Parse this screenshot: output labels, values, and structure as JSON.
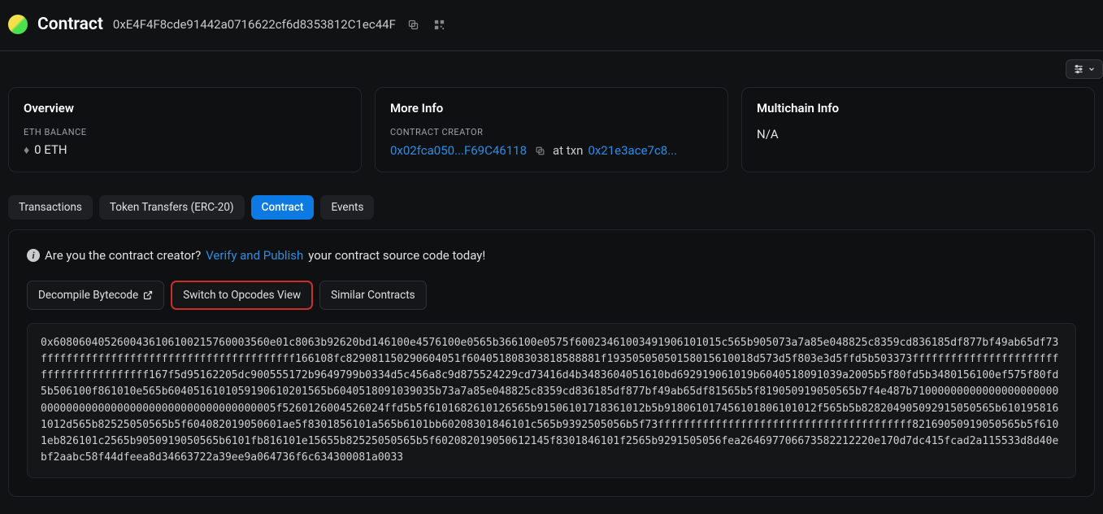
{
  "header": {
    "title": "Contract",
    "address": "0xE4F4F8cde91442a0716622cf6d8353812C1ec44F"
  },
  "cards": {
    "overview": {
      "title": "Overview",
      "balance_label": "ETH BALANCE",
      "balance_value": "0 ETH"
    },
    "moreinfo": {
      "title": "More Info",
      "creator_label": "CONTRACT CREATOR",
      "creator_address": "0x02fca050...F69C46118",
      "at_txn": "at txn",
      "txn_hash": "0x21e3ace7c8..."
    },
    "multichain": {
      "title": "Multichain Info",
      "value": "N/A"
    }
  },
  "tabs": {
    "transactions": "Transactions",
    "token_transfers": "Token Transfers (ERC-20)",
    "contract": "Contract",
    "events": "Events"
  },
  "verify": {
    "prefix": "Are you the contract creator?",
    "link": "Verify and Publish",
    "suffix": "your contract source code today!"
  },
  "actions": {
    "decompile": "Decompile Bytecode",
    "opcodes": "Switch to Opcodes View",
    "similar": "Similar Contracts"
  },
  "bytecode": "0x6080604052600436106100215760003560e01c8063b92620bd146100e4576100e0565b366100e0575f60023461003491906101015c565b905073a7a85e048825c8359cd836185df877bf49ab65df73ffffffffffffffffffffffffffffffffffffffff166108fc829081150290604051f604051808303818588881f19350505050158015610018d573d5f803e3d5ffd5b503373ffffffffffffffffffffffffffffffffffffffff167f5d95162205dc900555172b9649799b0334d5c456a8c9d875524229cd73416d4b3483604051610bd692919061019b6040518091039a2005b5f80fd5b3480156100ef575f80fd5b506100f861010e565b6040516101059190610201565b6040518091039035b73a7a85e048825c8359cd836185df877bf49ab65df81565b5f819050919050565b7f4e487b710000000000000000000000000000000000000000000000000000000005f5260126004526024ffd5b5f6101682610126565b91506101718361012b5b918061017456101806101012f565b5b828204905092915050565b6101958161012d565b82525050565b5f604082019050601ae5f8301856101a565b6101bb60208301846101c565b9392505056b5f73ffffffffffffffffffffffffffffffffffffffff82169050919050565b5f6101eb826101c2565b9050919050565b6101fb816101e15655b82525050565b5f602082019050612145f8301846101f2565b9291505056fea264697706673582212220e170d7dc415fcad2a115533d8d40ebf2aabc58f44dfeea8d34663722a39ee9a064736f6c634300081a0033"
}
